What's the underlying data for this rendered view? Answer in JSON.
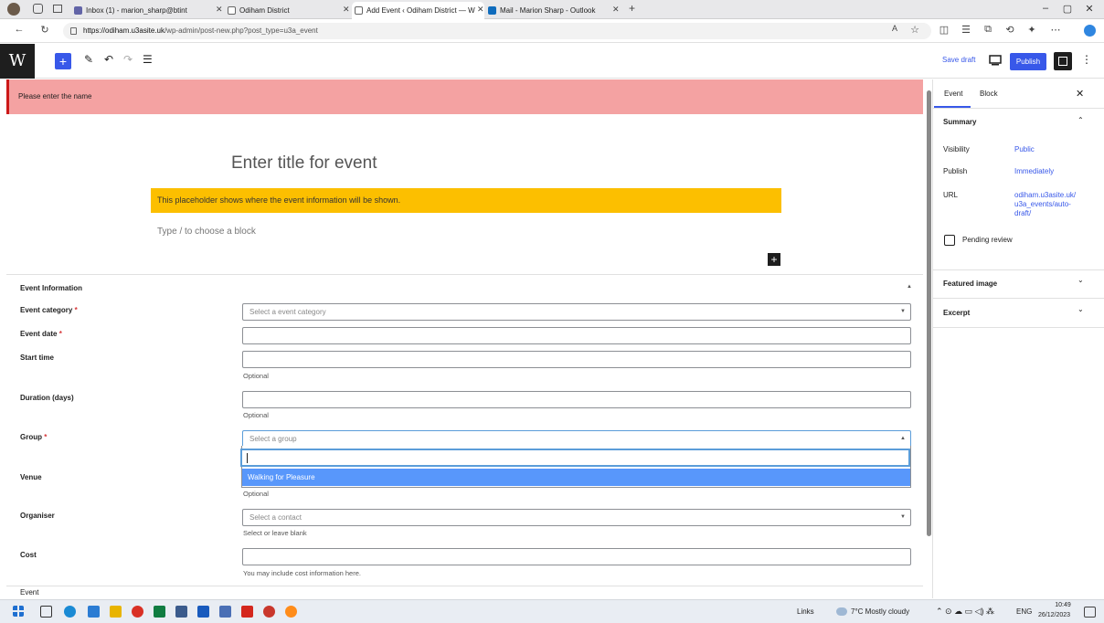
{
  "browser": {
    "tabs": [
      {
        "title": "Inbox (1) - marion_sharp@btint",
        "icon": "mail-icon",
        "color": "#6264a7"
      },
      {
        "title": "Odiham District",
        "icon": "page-icon",
        "color": "#666666"
      },
      {
        "title": "Add Event ‹ Odiham District — W",
        "icon": "page-icon",
        "color": "#666666",
        "active": true
      },
      {
        "title": "Mail - Marion Sharp - Outlook",
        "icon": "outlook-icon",
        "color": "#0f6cbd"
      }
    ],
    "new_tab": "+",
    "url_domain": "https://odiham.u3asite.uk",
    "url_path": "/wp-admin/post-new.php?post_type=u3a_event",
    "window_controls": [
      "–",
      "▢",
      "✕"
    ]
  },
  "toolbar": {
    "logo": "W",
    "add_block": "+",
    "save_draft": "Save draft",
    "publish": "Publish",
    "more": "⋮"
  },
  "notice": {
    "text": "Please enter the name"
  },
  "editor": {
    "title_placeholder": "Enter title for event",
    "event_placeholder": "This placeholder shows where the event information will be shown.",
    "block_hint": "Type / to choose a block",
    "inserter": "+"
  },
  "metabox": {
    "title": "Event Information",
    "toggle": "▲",
    "fields": {
      "category": {
        "label": "Event category",
        "required": "*",
        "placeholder": "Select a event category",
        "caret": "▼"
      },
      "date": {
        "label": "Event date",
        "required": "*"
      },
      "start": {
        "label": "Start time",
        "help": "Optional"
      },
      "duration": {
        "label": "Duration (days)",
        "help": "Optional"
      },
      "group": {
        "label": "Group",
        "required": "*",
        "placeholder": "Select a group",
        "caret": "▲",
        "option": "Walking for Pleasure"
      },
      "venue": {
        "label": "Venue",
        "help": "Optional"
      },
      "organiser": {
        "label": "Organiser",
        "placeholder": "Select a contact",
        "caret": "▼",
        "help": "Select or leave blank"
      },
      "cost": {
        "label": "Cost",
        "help": "You may include cost information here."
      }
    },
    "footer": "Event"
  },
  "sidebar": {
    "tab_event": "Event",
    "tab_block": "Block",
    "close": "✕",
    "summary": {
      "title": "Summary",
      "chevron": "⌃",
      "visibility_label": "Visibility",
      "visibility_value": "Public",
      "publish_label": "Publish",
      "publish_value": "Immediately",
      "url_label": "URL",
      "url_value_1": "odiham.u3asite.uk/",
      "url_value_2": "u3a_events/auto-",
      "url_value_3": "draft/",
      "pending": "Pending review"
    },
    "featured_image": "Featured image",
    "excerpt": "Excerpt",
    "chevron_down": "⌄"
  },
  "taskbar": {
    "links": "Links",
    "weather": "7°C  Mostly cloudy",
    "lang": "ENG",
    "time": "10:49",
    "date": "26/12/2023"
  },
  "colors": {
    "accent": "#3858e9",
    "notice": "#f4a2a2",
    "placeholder": "#fcbf00",
    "selected_option": "#5897fb"
  }
}
